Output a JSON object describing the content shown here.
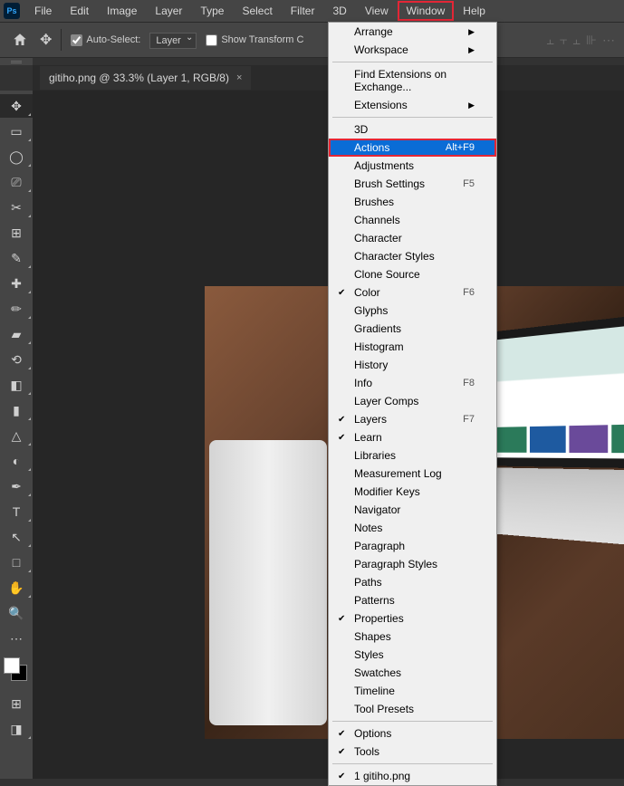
{
  "app": {
    "logo": "Ps"
  },
  "menubar": [
    "File",
    "Edit",
    "Image",
    "Layer",
    "Type",
    "Select",
    "Filter",
    "3D",
    "View",
    "Window",
    "Help"
  ],
  "menubar_highlight": "Window",
  "options": {
    "autoselect": "Auto-Select:",
    "layer": "Layer",
    "showtransform": "Show Transform C"
  },
  "tab": {
    "title": "gitiho.png @ 33.3% (Layer 1, RGB/8)"
  },
  "tools": [
    {
      "icon": "✥",
      "name": "move-tool",
      "sel": true,
      "tri": true
    },
    {
      "icon": "▭",
      "name": "marquee-tool",
      "tri": true
    },
    {
      "icon": "◯",
      "name": "lasso-tool",
      "tri": true
    },
    {
      "icon": "⎚",
      "name": "object-select-tool",
      "tri": true
    },
    {
      "icon": "✂",
      "name": "crop-tool",
      "tri": true
    },
    {
      "icon": "⊞",
      "name": "frame-tool"
    },
    {
      "icon": "✎",
      "name": "eyedropper-tool",
      "tri": true
    },
    {
      "icon": "✚",
      "name": "healing-tool",
      "tri": true
    },
    {
      "icon": "✏",
      "name": "brush-tool",
      "tri": true
    },
    {
      "icon": "▰",
      "name": "stamp-tool",
      "tri": true
    },
    {
      "icon": "⟲",
      "name": "history-brush-tool",
      "tri": true
    },
    {
      "icon": "◧",
      "name": "eraser-tool",
      "tri": true
    },
    {
      "icon": "▮",
      "name": "gradient-tool",
      "tri": true
    },
    {
      "icon": "△",
      "name": "blur-tool",
      "tri": true
    },
    {
      "icon": "◐",
      "name": "dodge-tool",
      "tri": true
    },
    {
      "icon": "✒",
      "name": "pen-tool",
      "tri": true
    },
    {
      "icon": "T",
      "name": "type-tool",
      "tri": true
    },
    {
      "icon": "↖",
      "name": "path-select-tool",
      "tri": true
    },
    {
      "icon": "□",
      "name": "rectangle-tool",
      "tri": true
    },
    {
      "icon": "✋",
      "name": "hand-tool",
      "tri": true
    },
    {
      "icon": "🔍",
      "name": "zoom-tool"
    },
    {
      "icon": "⋯",
      "name": "edit-toolbar"
    }
  ],
  "window_menu": {
    "section1": [
      {
        "label": "Arrange",
        "submenu": true
      },
      {
        "label": "Workspace",
        "submenu": true
      }
    ],
    "section2": [
      {
        "label": "Find Extensions on Exchange..."
      },
      {
        "label": "Extensions",
        "submenu": true
      }
    ],
    "section3": [
      {
        "label": "3D"
      },
      {
        "label": "Actions",
        "shortcut": "Alt+F9",
        "highlighted": true
      },
      {
        "label": "Adjustments"
      },
      {
        "label": "Brush Settings",
        "shortcut": "F5"
      },
      {
        "label": "Brushes"
      },
      {
        "label": "Channels"
      },
      {
        "label": "Character"
      },
      {
        "label": "Character Styles"
      },
      {
        "label": "Clone Source"
      },
      {
        "label": "Color",
        "shortcut": "F6",
        "checked": true
      },
      {
        "label": "Glyphs"
      },
      {
        "label": "Gradients"
      },
      {
        "label": "Histogram"
      },
      {
        "label": "History"
      },
      {
        "label": "Info",
        "shortcut": "F8"
      },
      {
        "label": "Layer Comps"
      },
      {
        "label": "Layers",
        "shortcut": "F7",
        "checked": true
      },
      {
        "label": "Learn",
        "checked": true
      },
      {
        "label": "Libraries"
      },
      {
        "label": "Measurement Log"
      },
      {
        "label": "Modifier Keys"
      },
      {
        "label": "Navigator"
      },
      {
        "label": "Notes"
      },
      {
        "label": "Paragraph"
      },
      {
        "label": "Paragraph Styles"
      },
      {
        "label": "Paths"
      },
      {
        "label": "Patterns"
      },
      {
        "label": "Properties",
        "checked": true
      },
      {
        "label": "Shapes"
      },
      {
        "label": "Styles"
      },
      {
        "label": "Swatches"
      },
      {
        "label": "Timeline"
      },
      {
        "label": "Tool Presets"
      }
    ],
    "section4": [
      {
        "label": "Options",
        "checked": true
      },
      {
        "label": "Tools",
        "checked": true
      }
    ],
    "section5": [
      {
        "label": "1 gitiho.png",
        "checked": true
      }
    ]
  }
}
